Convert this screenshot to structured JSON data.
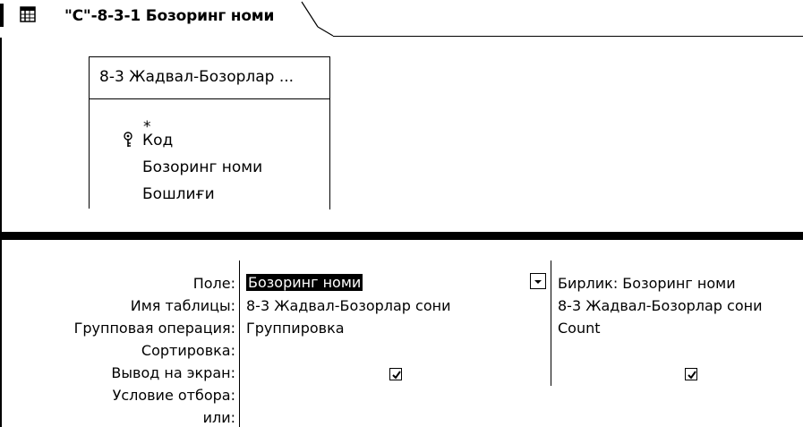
{
  "tab": {
    "title": "\"С\"-8-3-1 Бозоринг номи",
    "icon": "query-icon"
  },
  "field_list": {
    "title": "8-3 Жадвал-Бозорлар ...",
    "items": [
      "*",
      "Код",
      "Бозоринг номи",
      "Бошлиғи"
    ],
    "primary_key_icon": "key-icon"
  },
  "grid": {
    "row_labels": [
      "Поле:",
      "Имя таблицы:",
      "Групповая операция:",
      "Сортировка:",
      "Вывод на экран:",
      "Условие отбора:",
      "или:"
    ],
    "columns": [
      {
        "field": "Бозоринг номи",
        "table": "8-3 Жадвал-Бозорлар сони",
        "group": "Группировка",
        "show": true
      },
      {
        "field": "Бирлик: Бозоринг номи",
        "table": "8-3 Жадвал-Бозорлар сони",
        "group": "Count",
        "show": true
      }
    ]
  }
}
